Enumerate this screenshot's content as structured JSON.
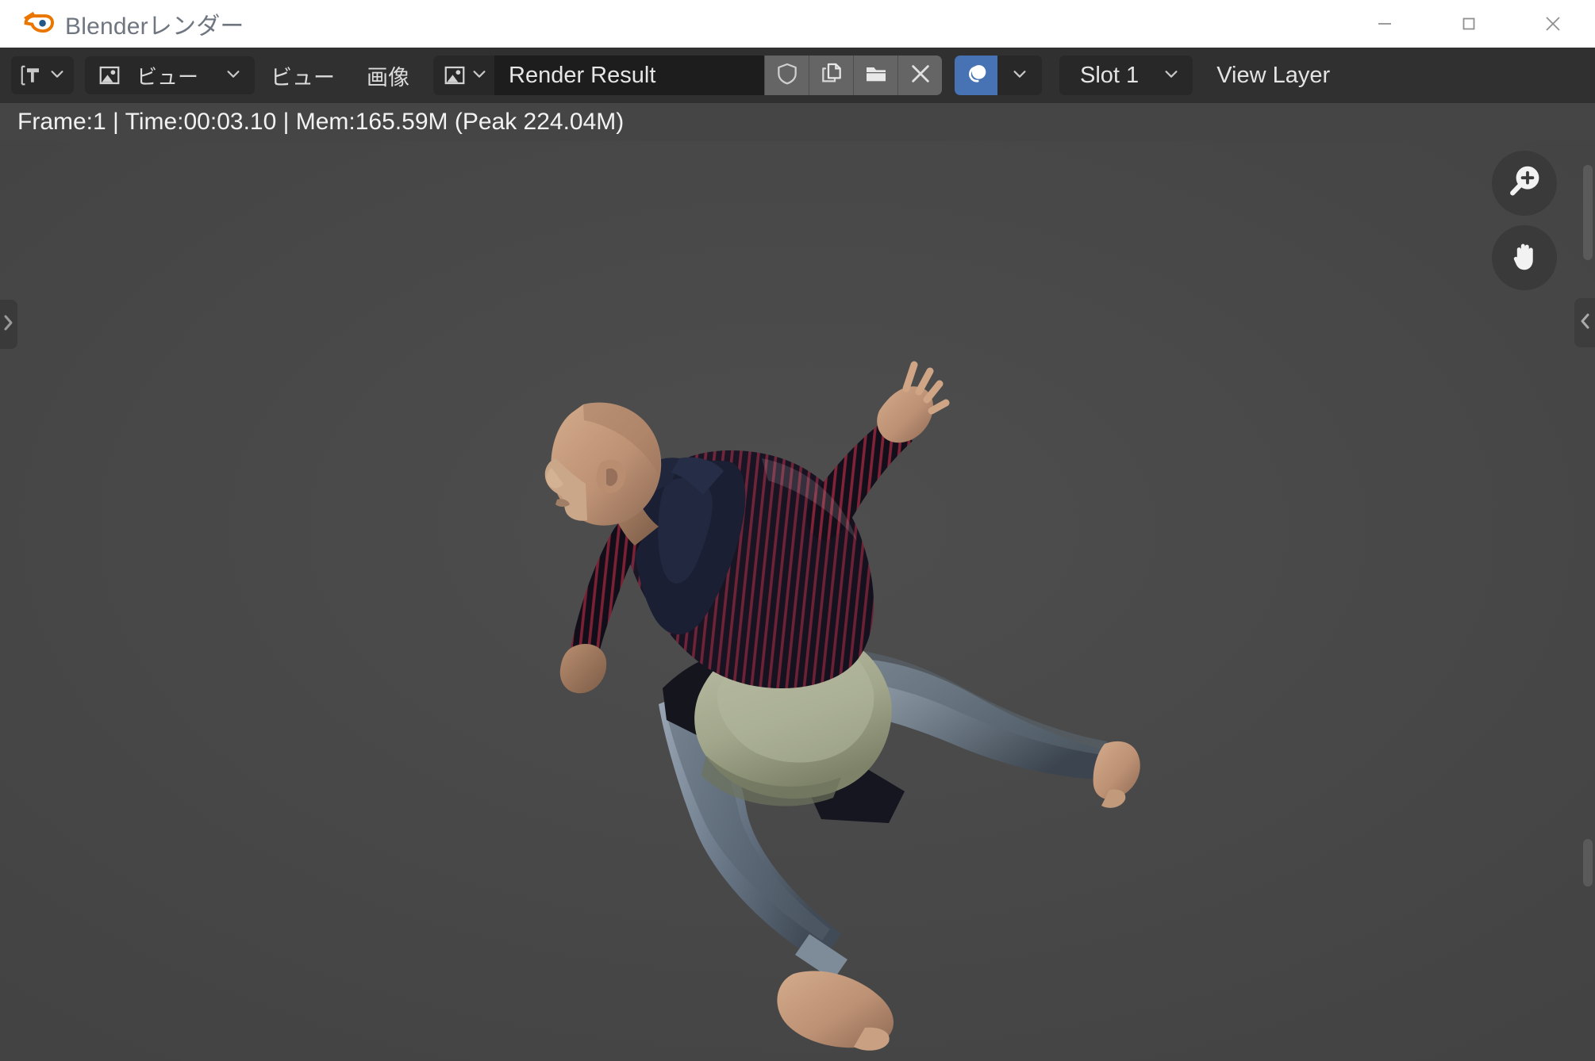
{
  "window": {
    "title": "Blenderレンダー",
    "logo_icon": "blender-logo-icon",
    "controls": [
      {
        "name": "minimize",
        "icon": "minimize-icon"
      },
      {
        "name": "maximize",
        "icon": "maximize-icon"
      },
      {
        "name": "close",
        "icon": "close-icon"
      }
    ]
  },
  "toolbar": {
    "editor_type": {
      "icon": "image-editor-type-icon",
      "chevron": "chevron-down-icon"
    },
    "mode_select": {
      "icon": "image-icon",
      "label": "ビュー",
      "chevron": "chevron-down-icon"
    },
    "menus": [
      {
        "name": "view-menu",
        "label": "ビュー"
      },
      {
        "name": "image-menu",
        "label": "画像"
      }
    ],
    "datablock": {
      "icon": "image-icon",
      "chevron": "chevron-down-icon",
      "name": "Render Result",
      "buttons": [
        {
          "name": "fake-user-button",
          "icon": "shield-icon"
        },
        {
          "name": "new-image-button",
          "icon": "copy-icon"
        },
        {
          "name": "open-image-button",
          "icon": "folder-icon"
        },
        {
          "name": "unlink-button",
          "icon": "close-x-icon"
        }
      ]
    },
    "display_channel": {
      "icon": "alpha-channel-icon",
      "chevron": "chevron-down-icon",
      "accent_color": "#4772b3"
    },
    "slot": {
      "label": "Slot 1",
      "chevron": "chevron-down-icon"
    },
    "view_layer": {
      "label": "View Layer"
    }
  },
  "stats": {
    "text": "Frame:1 | Time:00:03.10 | Mem:165.59M (Peak 224.04M)"
  },
  "canvas": {
    "background_color": "#464646",
    "edge_tabs": [
      {
        "name": "left-sidebar-toggle",
        "icon": "chevron-right-icon"
      },
      {
        "name": "right-sidebar-toggle",
        "icon": "chevron-left-icon"
      }
    ],
    "floating_buttons": [
      {
        "name": "zoom-in-button",
        "icon": "magnifier-plus-icon"
      },
      {
        "name": "pan-button",
        "icon": "hand-icon"
      }
    ],
    "render_subject": "3D rendered running human figure",
    "colors": {
      "skin": "#c29a7d",
      "shirt_dark": "#1b1f30",
      "shirt_stripe": "#b03048",
      "shorts": "#a8ad92",
      "jeans": "#7b8796"
    }
  }
}
